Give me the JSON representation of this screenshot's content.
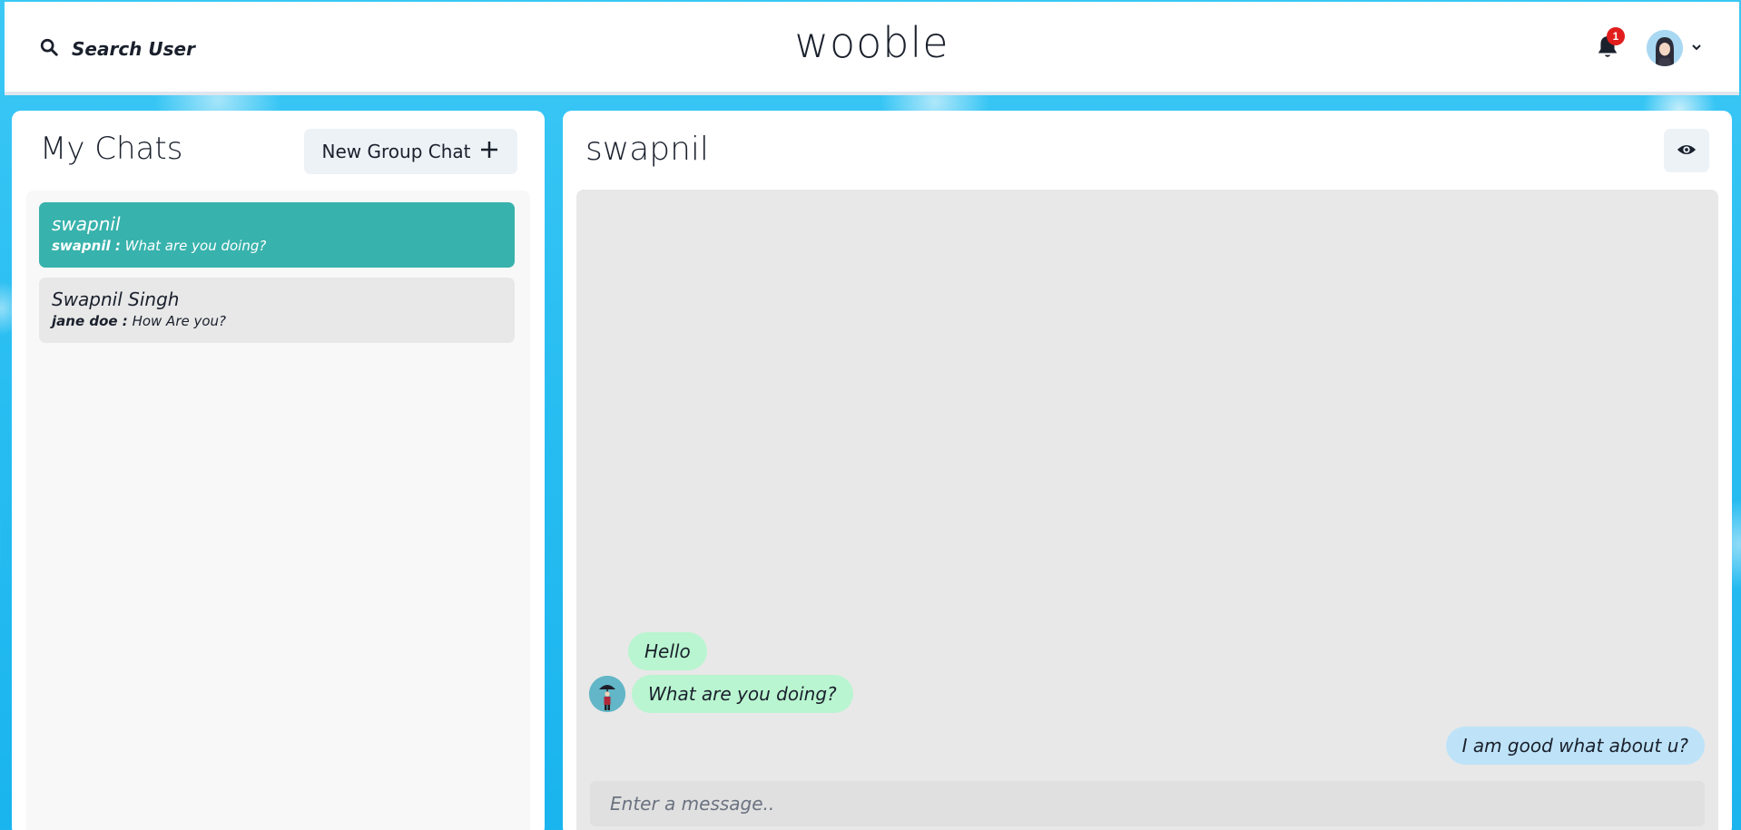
{
  "header": {
    "search_label": "Search User",
    "logo_text": "wooble",
    "notification_count": "1"
  },
  "left_panel": {
    "title": "My Chats",
    "new_group_label": "New Group Chat",
    "chats": [
      {
        "name": "swapnil",
        "sender": "swapnil :",
        "preview": "What are you doing?",
        "active": true
      },
      {
        "name": "Swapnil Singh",
        "sender": "jane doe :",
        "preview": "How Are you?",
        "active": false
      }
    ]
  },
  "conversation": {
    "title": "swapnil",
    "messages": [
      {
        "text": "Hello",
        "direction": "received"
      },
      {
        "text": "What are you doing?",
        "direction": "received"
      },
      {
        "text": "I am good what about u?",
        "direction": "sent"
      }
    ],
    "input_placeholder": "Enter a message.."
  },
  "colors": {
    "active_chat": "#38b2ac",
    "received_bubble": "#b9f5d0",
    "sent_bubble": "#bee3f8",
    "badge": "#e11d1d",
    "background": "#2bbff2"
  },
  "icons": {
    "search": "search-icon",
    "bell": "bell-icon",
    "plus": "plus-icon",
    "eye": "eye-icon",
    "chevron": "chevron-down-icon"
  }
}
